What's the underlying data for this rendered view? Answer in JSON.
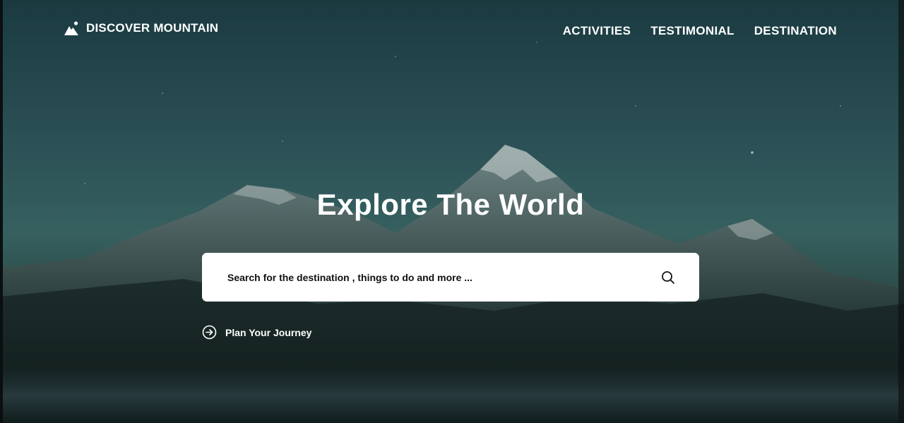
{
  "brand": {
    "name": "DISCOVER MOUNTAIN",
    "icon": "mountain-logo-icon"
  },
  "nav": {
    "items": [
      "ACTIVITIES",
      "TESTIMONIAL",
      "DESTINATION"
    ]
  },
  "hero": {
    "headline": "Explore The World"
  },
  "search": {
    "placeholder": "Search for the destination , things to do and more ...",
    "icon": "search-icon"
  },
  "cta": {
    "label": "Plan Your Journey",
    "icon": "arrow-right-circle-icon"
  },
  "colors": {
    "text": "#ffffff",
    "search_bg": "#ffffff",
    "sky_top": "#1a3a40",
    "sky_mid": "#36605f",
    "ground": "#0f1e1d"
  }
}
